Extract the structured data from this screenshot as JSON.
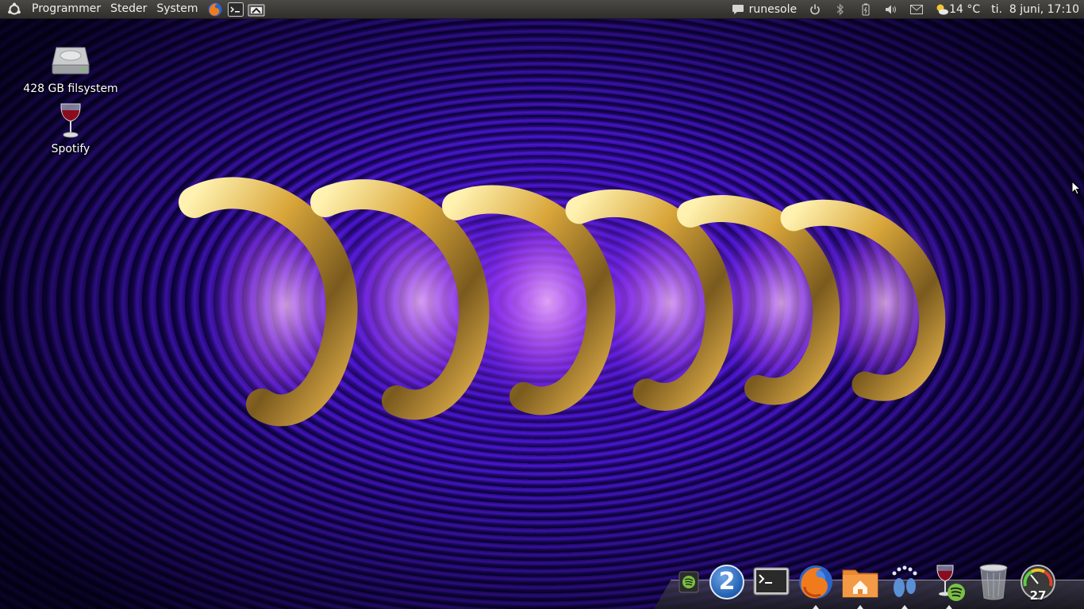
{
  "top_panel": {
    "menus": {
      "applications": "Programmer",
      "places": "Steder",
      "system": "System"
    },
    "launchers": [
      "firefox-icon",
      "terminal-icon",
      "screenshot-icon"
    ],
    "tray": {
      "user_name": "runesole",
      "weather": "14 °C",
      "clock": "ti.  8 juni, 17:10",
      "icons": [
        "chat-icon",
        "power-icon",
        "bluetooth-icon",
        "battery-icon",
        "volume-icon",
        "mail-icon",
        "weather-icon"
      ]
    }
  },
  "desktop": {
    "icons": [
      {
        "label": "428 GB filsystem",
        "icon": "hard-drive-icon"
      },
      {
        "label": "Spotify",
        "icon": "wine-glass-icon"
      }
    ]
  },
  "dock": {
    "items": [
      "spotify-small-icon",
      "workspace-switcher",
      "terminal-icon",
      "firefox-icon",
      "home-folder-icon",
      "gnome-foot-icon",
      "spotify-wine-icon",
      "trash-icon",
      "system-monitor-gauge"
    ],
    "workspace_number": "2",
    "gauge_value": "27"
  },
  "colors": {
    "panel_bg": "#3a3935",
    "wallpaper_primary": "#4a18d0",
    "wallpaper_dark": "#050018",
    "ring_gold": "#d9a63a",
    "ws_badge_blue": "#1f5db0"
  }
}
